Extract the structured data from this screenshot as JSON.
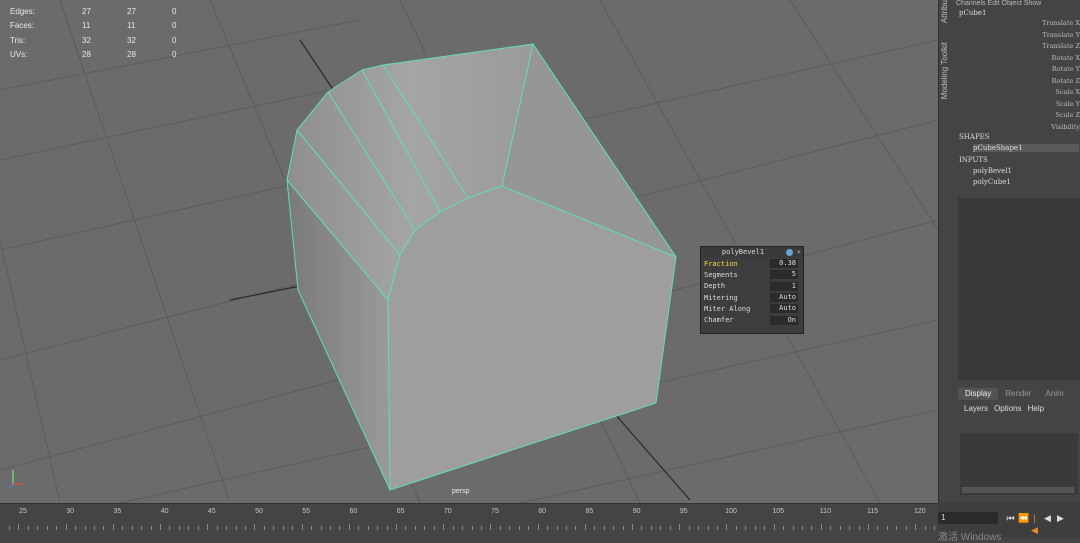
{
  "hud": {
    "rows": [
      {
        "label": "Edges:",
        "v1": "27",
        "v2": "27",
        "v3": "0"
      },
      {
        "label": "Faces:",
        "v1": "11",
        "v2": "11",
        "v3": "0"
      },
      {
        "label": "Tris:",
        "v1": "32",
        "v2": "32",
        "v3": "0"
      },
      {
        "label": "UVs:",
        "v1": "28",
        "v2": "28",
        "v3": "0"
      }
    ]
  },
  "camera_label": "persp",
  "bevel_popup": {
    "title": "polyBevel1",
    "rows": [
      {
        "label": "Fraction",
        "value": "0.38"
      },
      {
        "label": "Segments",
        "value": "5"
      },
      {
        "label": "Depth",
        "value": "1"
      },
      {
        "label": "Mitering",
        "value": "Auto"
      },
      {
        "label": "Miter Along",
        "value": "Auto"
      },
      {
        "label": "Chamfer",
        "value": "On"
      }
    ]
  },
  "side_tabs": {
    "attribute": "Attribu",
    "modeling_toolkit": "Modeling Toolkit"
  },
  "channel_box": {
    "menu": "Channels  Edit  Object  Show",
    "object_name": "pCube1",
    "attributes": [
      "Translate X",
      "Translate Y",
      "Translate Z",
      "Rotate X",
      "Rotate Y",
      "Rotate Z",
      "Scale X",
      "Scale Y",
      "Scale Z",
      "Visibility"
    ],
    "shapes_header": "SHAPES",
    "shape_node": "pCubeShape1",
    "inputs_header": "INPUTS",
    "input_nodes": [
      "polyBevel1",
      "polyCube1"
    ]
  },
  "layer_editor": {
    "tabs": [
      "Display",
      "Render",
      "Anim"
    ],
    "menu": [
      "Layers",
      "Options",
      "Help"
    ]
  },
  "timeline": {
    "ticks": [
      "25",
      "30",
      "35",
      "40",
      "45",
      "50",
      "55",
      "60",
      "65",
      "70",
      "75",
      "80",
      "85",
      "90",
      "95",
      "100",
      "105",
      "110",
      "115",
      "120"
    ],
    "current_frame": "1",
    "watermark": "激活 Windows"
  },
  "colors": {
    "viewport_bg": "#6b6b6b",
    "selection_edges": "#5fe0b4",
    "panel_bg": "#444444"
  }
}
